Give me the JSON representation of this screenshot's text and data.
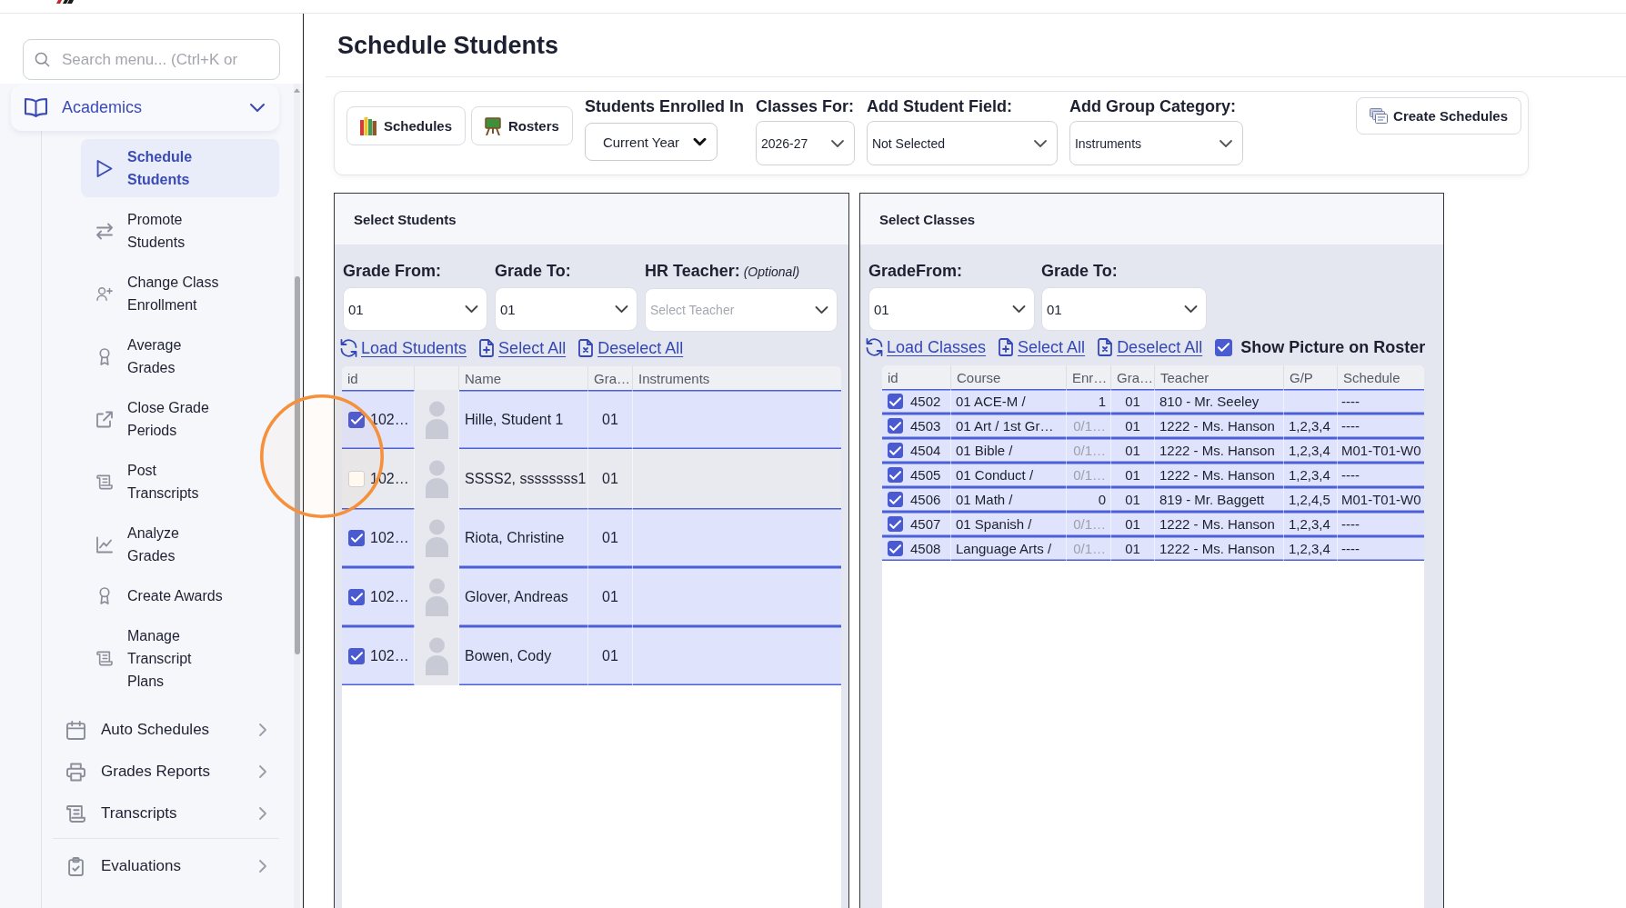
{
  "page": {
    "title": "Schedule Students"
  },
  "sidebar": {
    "search": {
      "placeholder": "Search menu... (Ctrl+K or"
    },
    "groups": [
      {
        "items": [
          {
            "label": "Academics",
            "expanded": true,
            "children": [
              {
                "label": "Schedule Students",
                "selected": true
              },
              {
                "label": "Promote Students",
                "selected": false
              },
              {
                "label": "Change Class Enrollment",
                "selected": false
              },
              {
                "label": "Average Grades",
                "selected": false
              },
              {
                "label": "Close Grade Periods",
                "selected": false
              },
              {
                "label": "Post Transcripts",
                "selected": false
              },
              {
                "label": "Analyze Grades",
                "selected": false
              },
              {
                "label": "Create Awards",
                "selected": false
              },
              {
                "label": "Manage Transcript Plans",
                "selected": false
              }
            ]
          },
          {
            "label": "Auto Schedules",
            "expanded": false
          },
          {
            "label": "Grades Reports",
            "expanded": false
          },
          {
            "label": "Transcripts",
            "expanded": false
          }
        ]
      },
      {
        "items": [
          {
            "label": "Evaluations",
            "expanded": false
          }
        ]
      }
    ]
  },
  "toolbar": {
    "buttons": [
      "Schedules",
      "Rosters"
    ],
    "fields": [
      {
        "kind": "select",
        "label": "Students Enrolled In",
        "value": "Current Year"
      },
      {
        "kind": "dropdown",
        "label": "Classes For:",
        "value": "2026-27"
      },
      {
        "kind": "dropdown",
        "label": "Add Student Field:",
        "value": "Not Selected"
      },
      {
        "kind": "dropdown",
        "label": "Add Group Category:",
        "value": "Instruments"
      }
    ],
    "create_button": "Create Schedules"
  },
  "students": {
    "title": "Select Students",
    "filters": [
      {
        "label": "Grade From:",
        "value": "01"
      },
      {
        "label": "Grade To:",
        "value": "01"
      },
      {
        "label": "HR Teacher:",
        "note": "(Optional)",
        "placeholder": "Select Teacher"
      }
    ],
    "actions": [
      "Load Students",
      "Select All",
      "Deselect All"
    ],
    "table": {
      "columns": [
        {
          "kind": "text",
          "label": "id"
        },
        {
          "kind": "photo"
        },
        {
          "kind": "text",
          "label": "Name"
        },
        {
          "kind": "text",
          "label": "Gra…"
        },
        {
          "kind": "text",
          "label": "Instruments"
        }
      ],
      "rows": [
        {
          "selected": true,
          "id": "102…",
          "name": "Hille, Student 1",
          "grade": "01"
        },
        {
          "selected": false,
          "id": "102…",
          "name": "SSSS2, ssssssss1",
          "grade": "01"
        },
        {
          "selected": true,
          "id": "102…",
          "name": "Riota, Christine",
          "grade": "01"
        },
        {
          "selected": true,
          "id": "102…",
          "name": "Glover, Andreas",
          "grade": "01"
        },
        {
          "selected": true,
          "id": "102…",
          "name": "Bowen, Cody",
          "grade": "01"
        }
      ]
    }
  },
  "classes": {
    "title": "Select Classes",
    "filters": [
      {
        "label": "GradeFrom:",
        "value": "01"
      },
      {
        "label": "Grade To:",
        "value": "01"
      }
    ],
    "actions": [
      "Load Classes",
      "Select All",
      "Deselect All"
    ],
    "show_picture": {
      "label": "Show Picture on Roster",
      "checked": true
    },
    "table": {
      "columns": [
        "id",
        "Course",
        "Enr…",
        "Gra…",
        "Teacher",
        "G/P",
        "Schedule"
      ],
      "rows": [
        {
          "selected": true,
          "id": "4502",
          "course": "01 ACE-M /",
          "enrolled": "1",
          "enrolled_greyed": false,
          "grade": "01",
          "teacher": "810 - Mr. Seeley",
          "schedule": "----"
        },
        {
          "selected": true,
          "id": "4503",
          "course": "01 Art / 1st Gr…",
          "enrolled": "0/1…",
          "enrolled_greyed": true,
          "grade": "01",
          "teacher": "1222 - Ms. Hanson",
          "gp": "1,2,3,4",
          "schedule": "----"
        },
        {
          "selected": true,
          "id": "4504",
          "course": "01 Bible /",
          "enrolled": "0/1…",
          "enrolled_greyed": true,
          "grade": "01",
          "teacher": "1222 - Ms. Hanson",
          "gp": "1,2,3,4",
          "schedule": "M01-T01-W0"
        },
        {
          "selected": true,
          "id": "4505",
          "course": "01 Conduct /",
          "enrolled": "0/1…",
          "enrolled_greyed": true,
          "grade": "01",
          "teacher": "1222 - Ms. Hanson",
          "gp": "1,2,3,4",
          "schedule": "----"
        },
        {
          "selected": true,
          "id": "4506",
          "course": "01 Math /",
          "enrolled": "0",
          "enrolled_greyed": false,
          "grade": "01",
          "teacher": "819 - Mr. Baggett",
          "gp": "1,2,4,5",
          "schedule": "M01-T01-W0"
        },
        {
          "selected": true,
          "id": "4507",
          "course": "01 Spanish /",
          "enrolled": "0/1…",
          "enrolled_greyed": true,
          "grade": "01",
          "teacher": "1222 - Ms. Hanson",
          "gp": "1,2,3,4",
          "schedule": "----"
        },
        {
          "selected": true,
          "id": "4508",
          "course": "Language Arts /",
          "enrolled": "0/1…",
          "enrolled_greyed": true,
          "grade": "01",
          "teacher": "1222 - Ms. Hanson",
          "gp": "1,2,3,4",
          "schedule": "----"
        }
      ]
    }
  }
}
